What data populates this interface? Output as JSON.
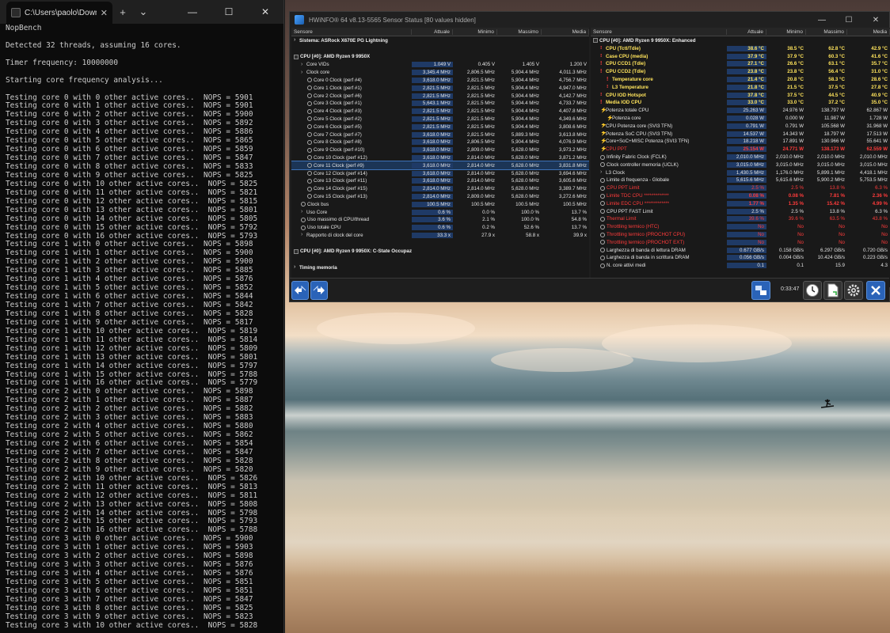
{
  "terminal": {
    "tab_title": "C:\\Users\\paolo\\Downloads\\N",
    "lines": [
      "NopBench",
      "",
      "Detected 32 threads, assuming 16 cores.",
      "",
      "Timer frequency: 10000000",
      "",
      "Starting core frequency analysis...",
      "",
      "Testing core 0 with 0 other active cores..  NOPS = 5901",
      "Testing core 0 with 1 other active cores..  NOPS = 5901",
      "Testing core 0 with 2 other active cores..  NOPS = 5900",
      "Testing core 0 with 3 other active cores..  NOPS = 5892",
      "Testing core 0 with 4 other active cores..  NOPS = 5886",
      "Testing core 0 with 5 other active cores..  NOPS = 5865",
      "Testing core 0 with 6 other active cores..  NOPS = 5859",
      "Testing core 0 with 7 other active cores..  NOPS = 5847",
      "Testing core 0 with 8 other active cores..  NOPS = 5833",
      "Testing core 0 with 9 other active cores..  NOPS = 5825",
      "Testing core 0 with 10 other active cores..  NOPS = 5825",
      "Testing core 0 with 11 other active cores..  NOPS = 5821",
      "Testing core 0 with 12 other active cores..  NOPS = 5815",
      "Testing core 0 with 13 other active cores..  NOPS = 5801",
      "Testing core 0 with 14 other active cores..  NOPS = 5805",
      "Testing core 0 with 15 other active cores..  NOPS = 5792",
      "Testing core 0 with 16 other active cores..  NOPS = 5793",
      "Testing core 1 with 0 other active cores..  NOPS = 5898",
      "Testing core 1 with 1 other active cores..  NOPS = 5900",
      "Testing core 1 with 2 other active cores..  NOPS = 5900",
      "Testing core 1 with 3 other active cores..  NOPS = 5885",
      "Testing core 1 with 4 other active cores..  NOPS = 5876",
      "Testing core 1 with 5 other active cores..  NOPS = 5852",
      "Testing core 1 with 6 other active cores..  NOPS = 5844",
      "Testing core 1 with 7 other active cores..  NOPS = 5842",
      "Testing core 1 with 8 other active cores..  NOPS = 5828",
      "Testing core 1 with 9 other active cores..  NOPS = 5817",
      "Testing core 1 with 10 other active cores..  NOPS = 5819",
      "Testing core 1 with 11 other active cores..  NOPS = 5814",
      "Testing core 1 with 12 other active cores..  NOPS = 5809",
      "Testing core 1 with 13 other active cores..  NOPS = 5801",
      "Testing core 1 with 14 other active cores..  NOPS = 5797",
      "Testing core 1 with 15 other active cores..  NOPS = 5788",
      "Testing core 1 with 16 other active cores..  NOPS = 5779",
      "Testing core 2 with 0 other active cores..  NOPS = 5898",
      "Testing core 2 with 1 other active cores..  NOPS = 5887",
      "Testing core 2 with 2 other active cores..  NOPS = 5882",
      "Testing core 2 with 3 other active cores..  NOPS = 5883",
      "Testing core 2 with 4 other active cores..  NOPS = 5880",
      "Testing core 2 with 5 other active cores..  NOPS = 5862",
      "Testing core 2 with 6 other active cores..  NOPS = 5854",
      "Testing core 2 with 7 other active cores..  NOPS = 5847",
      "Testing core 2 with 8 other active cores..  NOPS = 5828",
      "Testing core 2 with 9 other active cores..  NOPS = 5820",
      "Testing core 2 with 10 other active cores..  NOPS = 5826",
      "Testing core 2 with 11 other active cores..  NOPS = 5813",
      "Testing core 2 with 12 other active cores..  NOPS = 5811",
      "Testing core 2 with 13 other active cores..  NOPS = 5808",
      "Testing core 2 with 14 other active cores..  NOPS = 5798",
      "Testing core 2 with 15 other active cores..  NOPS = 5793",
      "Testing core 2 with 16 other active cores..  NOPS = 5788",
      "Testing core 3 with 0 other active cores..  NOPS = 5900",
      "Testing core 3 with 1 other active cores..  NOPS = 5903",
      "Testing core 3 with 2 other active cores..  NOPS = 5898",
      "Testing core 3 with 3 other active cores..  NOPS = 5876",
      "Testing core 3 with 4 other active cores..  NOPS = 5876",
      "Testing core 3 with 5 other active cores..  NOPS = 5851",
      "Testing core 3 with 6 other active cores..  NOPS = 5851",
      "Testing core 3 with 7 other active cores..  NOPS = 5847",
      "Testing core 3 with 8 other active cores..  NOPS = 5825",
      "Testing core 3 with 9 other active cores..  NOPS = 5823",
      "Testing core 3 with 10 other active cores..  NOPS = 5828"
    ]
  },
  "hwinfo": {
    "title": "HWiNFO® 64 v8.13-5565 Sensor Status [80 values hidden]",
    "timer": "0:33:47",
    "left": {
      "headers": [
        "Sensore",
        "Attuale",
        "Minimo",
        "Massimo",
        "Media"
      ],
      "rows": [
        {
          "kind": "group",
          "icon": "chev",
          "label": "Sistema: ASRock X670E PG Lightning",
          "vals": [
            "",
            "",
            "",
            ""
          ]
        },
        {
          "kind": "sep",
          "label": "",
          "vals": [
            "",
            "",
            "",
            ""
          ]
        },
        {
          "kind": "group",
          "icon": "cpu",
          "label": "CPU [#0]: AMD Ryzen 9 9950X",
          "vals": [
            "",
            "",
            "",
            ""
          ]
        },
        {
          "ind": 1,
          "icon": "chev",
          "label": "Core VIDs",
          "vals": [
            "1.049 V",
            "0.405 V",
            "1.405 V",
            "1.200 V"
          ]
        },
        {
          "ind": 1,
          "icon": "chev",
          "label": "Clock core",
          "vals": [
            "3,345.4 MHz",
            "2,806.5 MHz",
            "5,904.4 MHz",
            "4,011.3 MHz"
          ]
        },
        {
          "ind": 2,
          "icon": "clock",
          "label": "Core 0 Clock (perf #4)",
          "vals": [
            "3,618.0 MHz",
            "2,821.5 MHz",
            "5,904.4 MHz",
            "4,756.7 MHz"
          ]
        },
        {
          "ind": 2,
          "icon": "clock",
          "label": "Core 1 Clock (perf #1)",
          "vals": [
            "2,821.5 MHz",
            "2,821.5 MHz",
            "5,904.4 MHz",
            "4,947.0 MHz"
          ]
        },
        {
          "ind": 2,
          "icon": "clock",
          "label": "Core 2 Clock (perf #6)",
          "vals": [
            "2,821.5 MHz",
            "2,821.5 MHz",
            "5,904.4 MHz",
            "4,142.7 MHz"
          ]
        },
        {
          "ind": 2,
          "icon": "clock",
          "label": "Core 3 Clock (perf #1)",
          "vals": [
            "5,643.1 MHz",
            "2,821.5 MHz",
            "5,904.4 MHz",
            "4,733.7 MHz"
          ]
        },
        {
          "ind": 2,
          "icon": "clock",
          "label": "Core 4 Clock (perf #3)",
          "vals": [
            "2,821.5 MHz",
            "2,821.5 MHz",
            "5,904.4 MHz",
            "4,407.8 MHz"
          ]
        },
        {
          "ind": 2,
          "icon": "clock",
          "label": "Core 5 Clock (perf #2)",
          "vals": [
            "2,821.5 MHz",
            "2,821.5 MHz",
            "5,904.4 MHz",
            "4,349.6 MHz"
          ]
        },
        {
          "ind": 2,
          "icon": "clock",
          "label": "Core 6 Clock (perf #5)",
          "vals": [
            "2,821.5 MHz",
            "2,821.5 MHz",
            "5,904.4 MHz",
            "3,808.6 MHz"
          ]
        },
        {
          "ind": 2,
          "icon": "clock",
          "label": "Core 7 Clock (perf #7)",
          "vals": [
            "3,618.0 MHz",
            "2,821.5 MHz",
            "5,889.3 MHz",
            "3,613.8 MHz"
          ]
        },
        {
          "ind": 2,
          "icon": "clock",
          "label": "Core 8 Clock (perf #8)",
          "vals": [
            "3,618.0 MHz",
            "2,806.5 MHz",
            "5,904.4 MHz",
            "4,076.9 MHz"
          ]
        },
        {
          "ind": 2,
          "icon": "clock",
          "label": "Core 9 Clock (perf #10)",
          "vals": [
            "3,618.0 MHz",
            "2,809.0 MHz",
            "5,628.0 MHz",
            "3,973.2 MHz"
          ]
        },
        {
          "ind": 2,
          "icon": "clock",
          "label": "Core 10 Clock (perf #12)",
          "vals": [
            "3,618.0 MHz",
            "2,814.0 MHz",
            "5,628.0 MHz",
            "3,871.2 MHz"
          ]
        },
        {
          "ind": 2,
          "icon": "clock",
          "label": "Core 11 Clock (perf #9)",
          "vals": [
            "3,618.0 MHz",
            "2,814.0 MHz",
            "5,628.0 MHz",
            "3,831.8 MHz"
          ],
          "sel": true
        },
        {
          "ind": 2,
          "icon": "clock",
          "label": "Core 12 Clock (perf #14)",
          "vals": [
            "3,618.0 MHz",
            "2,814.0 MHz",
            "5,628.0 MHz",
            "3,694.6 MHz"
          ]
        },
        {
          "ind": 2,
          "icon": "clock",
          "label": "Core 13 Clock (perf #11)",
          "vals": [
            "3,618.0 MHz",
            "2,814.0 MHz",
            "5,628.0 MHz",
            "3,605.6 MHz"
          ]
        },
        {
          "ind": 2,
          "icon": "clock",
          "label": "Core 14 Clock (perf #15)",
          "vals": [
            "2,814.0 MHz",
            "2,814.0 MHz",
            "5,628.0 MHz",
            "3,389.7 MHz"
          ]
        },
        {
          "ind": 2,
          "icon": "clock",
          "label": "Core 15 Clock (perf #13)",
          "vals": [
            "2,814.0 MHz",
            "2,809.0 MHz",
            "5,628.0 MHz",
            "3,272.6 MHz"
          ]
        },
        {
          "ind": 1,
          "icon": "clock",
          "label": "Clock bus",
          "vals": [
            "100.5 MHz",
            "100.5 MHz",
            "100.5 MHz",
            "100.5 MHz"
          ]
        },
        {
          "ind": 1,
          "icon": "chev",
          "label": "Uso Core",
          "vals": [
            "0.6 %",
            "0.0 %",
            "100.0 %",
            "13.7 %"
          ]
        },
        {
          "ind": 1,
          "icon": "clock",
          "label": "Uso massimo di CPU/thread",
          "vals": [
            "3.6 %",
            "2.1 %",
            "100.0 %",
            "54.8 %"
          ]
        },
        {
          "ind": 1,
          "icon": "clock",
          "label": "Uso totale CPU",
          "vals": [
            "0.6 %",
            "0.2 %",
            "52.6 %",
            "13.7 %"
          ]
        },
        {
          "ind": 1,
          "icon": "chev",
          "label": "Rapporto di clock del core",
          "vals": [
            "33.3 x",
            "27.9 x",
            "58.8 x",
            "39.9 x"
          ]
        },
        {
          "kind": "sep",
          "label": "",
          "vals": [
            "",
            "",
            "",
            ""
          ]
        },
        {
          "kind": "group",
          "icon": "cpu",
          "label": "CPU [#0]: AMD Ryzen 9 9950X: C-State Occupazione",
          "vals": [
            "",
            "",
            "",
            ""
          ]
        },
        {
          "kind": "sep",
          "label": "",
          "vals": [
            "",
            "",
            "",
            ""
          ]
        },
        {
          "kind": "group",
          "icon": "chev",
          "label": "Timing memoria",
          "vals": [
            "",
            "",
            "",
            ""
          ]
        }
      ]
    },
    "right": {
      "headers": [
        "Sensore",
        "Attuale",
        "Minimo",
        "Massimo",
        "Media"
      ],
      "rows": [
        {
          "kind": "group",
          "icon": "cpu",
          "label": "CPU [#0]: AMD Ryzen 9 9950X: Enhanced",
          "vals": [
            "",
            "",
            "",
            ""
          ]
        },
        {
          "ind": 1,
          "icon": "warn",
          "label": "CPU (Tctl/Tdie)",
          "vals": [
            "38.6 °C",
            "38.5 °C",
            "62.8 °C",
            "42.9 °C"
          ],
          "style": "yellow"
        },
        {
          "ind": 1,
          "icon": "warn",
          "label": "Case CPU (media)",
          "vals": [
            "37.9 °C",
            "37.9 °C",
            "60.3 °C",
            "41.6 °C"
          ],
          "style": "yellow"
        },
        {
          "ind": 1,
          "icon": "warn",
          "label": "CPU CCD1 (Tdie)",
          "vals": [
            "27.1 °C",
            "26.6 °C",
            "63.1 °C",
            "35.7 °C"
          ],
          "style": "yellow"
        },
        {
          "ind": 1,
          "icon": "warn",
          "label": "CPU CCD2 (Tdie)",
          "vals": [
            "23.8 °C",
            "23.8 °C",
            "56.4 °C",
            "31.0 °C"
          ],
          "style": "yellow"
        },
        {
          "ind": 2,
          "icon": "warn",
          "label": "Temperature core",
          "vals": [
            "21.4 °C",
            "20.8 °C",
            "58.3 °C",
            "28.6 °C"
          ],
          "style": "yellow"
        },
        {
          "ind": 2,
          "icon": "warn",
          "label": "L3 Temperature",
          "vals": [
            "21.8 °C",
            "21.5 °C",
            "37.5 °C",
            "27.8 °C"
          ],
          "style": "yellow"
        },
        {
          "ind": 1,
          "icon": "warn",
          "label": "CPU IOD Hotspot",
          "vals": [
            "37.8 °C",
            "37.5 °C",
            "44.5 °C",
            "40.9 °C"
          ],
          "style": "yellow"
        },
        {
          "ind": 1,
          "icon": "warn",
          "label": "Media IOD CPU",
          "vals": [
            "33.0 °C",
            "33.0 °C",
            "37.2 °C",
            "35.0 °C"
          ],
          "style": "yellow"
        },
        {
          "ind": 1,
          "icon": "bolt",
          "label": "Potenza totale CPU",
          "vals": [
            "25.263 W",
            "24.976 W",
            "138.797 W",
            "62.867 W"
          ]
        },
        {
          "ind": 2,
          "icon": "bolt",
          "label": "Potenza core",
          "vals": [
            "0.028 W",
            "0.000 W",
            "11.987 W",
            "1.728 W"
          ]
        },
        {
          "ind": 1,
          "icon": "bolt",
          "label": "CPU Potenza core (SVI3 TFN)",
          "vals": [
            "0.791 W",
            "0.791 W",
            "105.568 W",
            "31.968 W"
          ]
        },
        {
          "ind": 1,
          "icon": "bolt",
          "label": "Potenza SoC CPU (SVI3 TFN)",
          "vals": [
            "14.537 W",
            "14.343 W",
            "18.797 W",
            "17.513 W"
          ]
        },
        {
          "ind": 1,
          "icon": "bolt",
          "label": "Core+SoC+MISC Potenza (SVI3 TFN)",
          "vals": [
            "18.218 W",
            "17.891 W",
            "130.966 W",
            "55.641 W"
          ]
        },
        {
          "ind": 1,
          "icon": "bolt",
          "label": "CPU PPT",
          "vals": [
            "25.154 W",
            "24.771 W",
            "138.173 W",
            "62.559 W"
          ],
          "style": "red"
        },
        {
          "ind": 1,
          "icon": "clock",
          "label": "Infinity Fabric Clock (FCLK)",
          "vals": [
            "2,010.0 MHz",
            "2,010.0 MHz",
            "2,010.0 MHz",
            "2,010.0 MHz"
          ]
        },
        {
          "ind": 1,
          "icon": "clock",
          "label": "Clock controller memoria (UCLK)",
          "vals": [
            "3,015.0 MHz",
            "3,015.0 MHz",
            "3,015.0 MHz",
            "3,015.0 MHz"
          ]
        },
        {
          "ind": 1,
          "icon": "chev",
          "label": "L3 Clock",
          "vals": [
            "1,430.5 MHz",
            "1,176.0 MHz",
            "5,899.1 MHz",
            "4,418.1 MHz"
          ]
        },
        {
          "ind": 1,
          "icon": "clock",
          "label": "Limite di frequenza - Globale",
          "vals": [
            "5,615.6 MHz",
            "5,615.6 MHz",
            "5,900.2 MHz",
            "5,753.5 MHz"
          ]
        },
        {
          "ind": 1,
          "icon": "clock",
          "label": "CPU PPT Limit",
          "vals": [
            "2.5 %",
            "2.5 %",
            "13.8 %",
            "6.3 %"
          ],
          "style": "redlbl"
        },
        {
          "ind": 1,
          "icon": "clock",
          "label": "Limite TDC CPU *************",
          "vals": [
            "0.08 %",
            "0.08 %",
            "7.81 %",
            "2.36 %"
          ],
          "style": "red"
        },
        {
          "ind": 1,
          "icon": "clock",
          "label": "Limite EDC CPU *************",
          "vals": [
            "1.77 %",
            "1.35 %",
            "15.42 %",
            "4.99 %"
          ],
          "style": "red"
        },
        {
          "ind": 1,
          "icon": "clock",
          "label": "CPU PPT FAST Limit",
          "vals": [
            "2.5 %",
            "2.5 %",
            "13.8 %",
            "6.3 %"
          ]
        },
        {
          "ind": 1,
          "icon": "clock",
          "label": "Thermal Limit",
          "vals": [
            "39.6 %",
            "39.6 %",
            "63.5 %",
            "43.8 %"
          ],
          "style": "redlbl"
        },
        {
          "ind": 1,
          "icon": "clock",
          "label": "Throttling termico (HTC)",
          "vals": [
            "No",
            "No",
            "No",
            "No"
          ],
          "style": "redlbl"
        },
        {
          "ind": 1,
          "icon": "clock",
          "label": "Throttling termico (PROCHOT CPU)",
          "vals": [
            "No",
            "No",
            "No",
            "No"
          ],
          "style": "redlbl"
        },
        {
          "ind": 1,
          "icon": "clock",
          "label": "Throttling termico (PROCHOT EXT)",
          "vals": [
            "No",
            "No",
            "No",
            "No"
          ],
          "style": "redlbl"
        },
        {
          "ind": 1,
          "icon": "clock",
          "label": "Larghezza di banda di lettura DRAM",
          "vals": [
            "0.677 GB/s",
            "0.158 GB/s",
            "6.297 GB/s",
            "0.720 GB/s"
          ]
        },
        {
          "ind": 1,
          "icon": "clock",
          "label": "Larghezza di banda in scrittura DRAM",
          "vals": [
            "0.056 GB/s",
            "0.004 GB/s",
            "10.424 GB/s",
            "0.223 GB/s"
          ]
        },
        {
          "ind": 1,
          "icon": "clock",
          "label": "N. core attivi medi",
          "vals": [
            "0.1",
            "0.1",
            "15.9",
            "4.3"
          ]
        }
      ]
    },
    "buttons": [
      {
        "name": "nav-back-button",
        "icon": "arrows-icon"
      },
      {
        "name": "nav-forward-button",
        "icon": "arrows-icon"
      },
      {
        "name": "network-button",
        "icon": "network-icon"
      },
      {
        "name": "timer-button",
        "icon": "clock-icon"
      },
      {
        "name": "report-button",
        "icon": "document-icon"
      },
      {
        "name": "settings-button",
        "icon": "gear-icon"
      },
      {
        "name": "close-sensors-button",
        "icon": "close-icon"
      }
    ]
  }
}
